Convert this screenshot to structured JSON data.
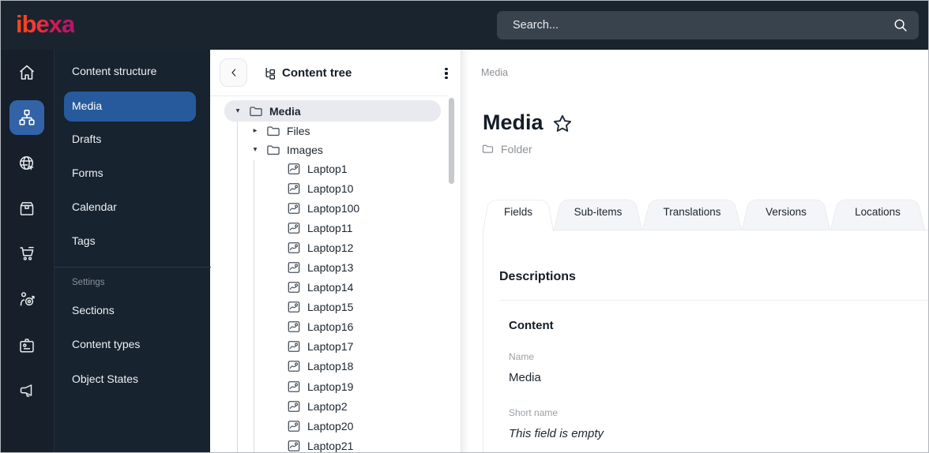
{
  "topbar": {
    "logo": "ibexa",
    "search": {
      "placeholder": "Search...",
      "icon": "search-icon"
    }
  },
  "rail": {
    "items": [
      {
        "icon": "home-icon",
        "active": false
      },
      {
        "icon": "content-structure-icon",
        "active": true
      },
      {
        "icon": "site-globe-icon",
        "active": false
      },
      {
        "icon": "product-catalog-icon",
        "active": false
      },
      {
        "icon": "commerce-cart-icon",
        "active": false
      },
      {
        "icon": "personalization-target-icon",
        "active": false
      },
      {
        "icon": "admin-badge-icon",
        "active": false
      },
      {
        "icon": "marketing-megaphone-icon",
        "active": false
      }
    ]
  },
  "nav": {
    "items": [
      {
        "label": "Content structure",
        "active": false
      },
      {
        "label": "Media",
        "active": true
      },
      {
        "label": "Drafts",
        "active": false
      },
      {
        "label": "Forms",
        "active": false
      },
      {
        "label": "Calendar",
        "active": false
      },
      {
        "label": "Tags",
        "active": false
      }
    ],
    "settings_label": "Settings",
    "settings_items": [
      {
        "label": "Sections"
      },
      {
        "label": "Content types"
      },
      {
        "label": "Object States"
      }
    ]
  },
  "tree": {
    "title": "Content tree",
    "root": {
      "label": "Media",
      "state": "expanded",
      "selected": true,
      "icon": "folder-icon"
    },
    "children": [
      {
        "label": "Files",
        "state": "collapsed",
        "icon": "folder-icon"
      },
      {
        "label": "Images",
        "state": "expanded",
        "icon": "folder-icon"
      }
    ],
    "images_children": [
      "Laptop1",
      "Laptop10",
      "Laptop100",
      "Laptop11",
      "Laptop12",
      "Laptop13",
      "Laptop14",
      "Laptop15",
      "Laptop16",
      "Laptop17",
      "Laptop18",
      "Laptop19",
      "Laptop2",
      "Laptop20",
      "Laptop21"
    ]
  },
  "main": {
    "breadcrumb": "Media",
    "title": "Media",
    "favorite_icon": "star-icon",
    "content_type": "Folder",
    "tabs": [
      {
        "label": "Fields",
        "active": true
      },
      {
        "label": "Sub-items",
        "active": false
      },
      {
        "label": "Translations",
        "active": false
      },
      {
        "label": "Versions",
        "active": false
      },
      {
        "label": "Locations",
        "active": false
      }
    ],
    "panel": {
      "section_title": "Descriptions",
      "group_title": "Content",
      "fields": [
        {
          "label": "Name",
          "value": "Media",
          "empty": false
        },
        {
          "label": "Short name",
          "value": "This field is empty",
          "empty": true
        }
      ]
    }
  },
  "colors": {
    "topbar_bg": "#1a242f",
    "nav_bg": "#17232f",
    "accent_blue_pill": "#265a9c",
    "accent_blue_rail": "#3263a6",
    "selected_tree_row": "#e9e9f0",
    "logo_gradient_start": "#ff4713",
    "logo_gradient_end": "#b5156c"
  }
}
